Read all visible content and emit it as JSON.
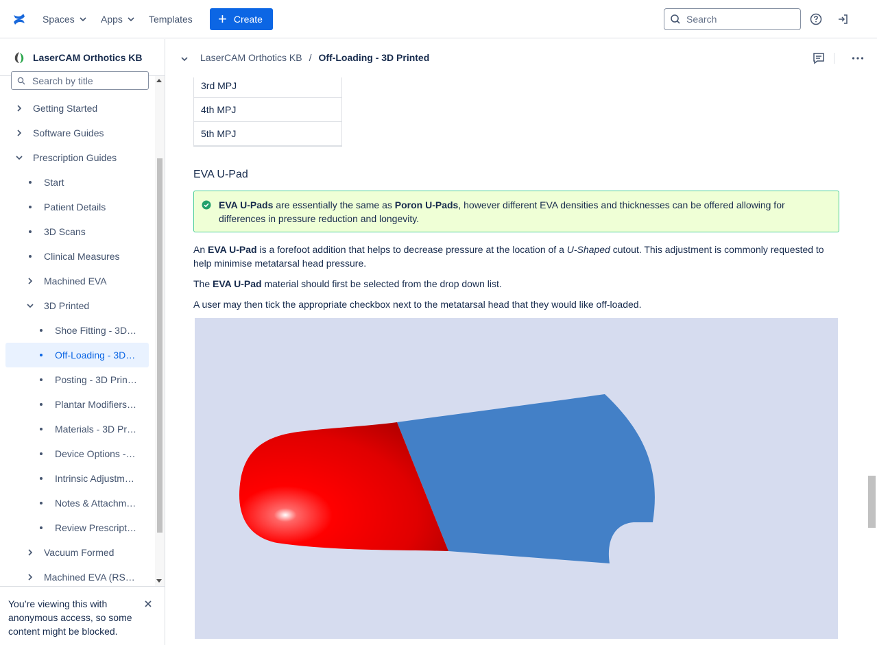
{
  "topnav": {
    "spaces": "Spaces",
    "apps": "Apps",
    "templates": "Templates",
    "create": "Create",
    "search_placeholder": "Search"
  },
  "sidebar": {
    "space_name": "LaserCAM Orthotics KB",
    "search_placeholder": "Search by title",
    "items": [
      {
        "label": "Getting Started"
      },
      {
        "label": "Software Guides"
      },
      {
        "label": "Prescription Guides"
      },
      {
        "label": "Start"
      },
      {
        "label": "Patient Details"
      },
      {
        "label": "3D Scans"
      },
      {
        "label": "Clinical Measures"
      },
      {
        "label": "Machined EVA"
      },
      {
        "label": "3D Printed"
      },
      {
        "label": "Shoe Fitting - 3D…"
      },
      {
        "label": "Off-Loading - 3D…"
      },
      {
        "label": "Posting - 3D Prin…"
      },
      {
        "label": "Plantar Modifiers…"
      },
      {
        "label": "Materials - 3D Pr…"
      },
      {
        "label": "Device Options -…"
      },
      {
        "label": "Intrinsic Adjustm…"
      },
      {
        "label": "Notes & Attachm…"
      },
      {
        "label": "Review Prescript…"
      },
      {
        "label": "Vacuum Formed"
      },
      {
        "label": "Machined EVA (RS…"
      }
    ],
    "anon_banner": "You’re viewing this with anonymous access, so some content might be blocked."
  },
  "header": {
    "breadcrumb_space": "LaserCAM Orthotics KB",
    "breadcrumb_sep": "/",
    "breadcrumb_current": "Off-Loading - 3D Printed"
  },
  "content": {
    "table_rows": [
      "3rd MPJ",
      "4th MPJ",
      "5th MPJ"
    ],
    "heading": "EVA U-Pad",
    "panel": {
      "b1": "EVA U-Pads",
      "t1": " are essentially the same as ",
      "b2": "Poron U-Pads",
      "t2": ", however different EVA densities and thicknesses can be offered allowing for differences in pressure reduction and longevity."
    },
    "p1": {
      "t1": "An ",
      "b1": "EVA U-Pad",
      "t2": " is a forefoot addition that helps to decrease pressure at the location of a ",
      "i1": "U-Shaped",
      "t3": " cutout. This adjustment is commonly requested to help minimise metatarsal head pressure."
    },
    "p2": {
      "t1": "The ",
      "b1": "EVA U-Pad",
      "t2": " material should first be selected from the drop down list."
    },
    "p3": "A user may then tick the appropriate checkbox next to the metatarsal head that they would like off-loaded."
  },
  "colors": {
    "primary": "#0c66e4",
    "panel_bg": "#efffd6",
    "panel_border": "#4bce97",
    "figure_bg": "#d6dcef",
    "insole_blue": "#4380c7",
    "pad_red": "#f00000"
  }
}
